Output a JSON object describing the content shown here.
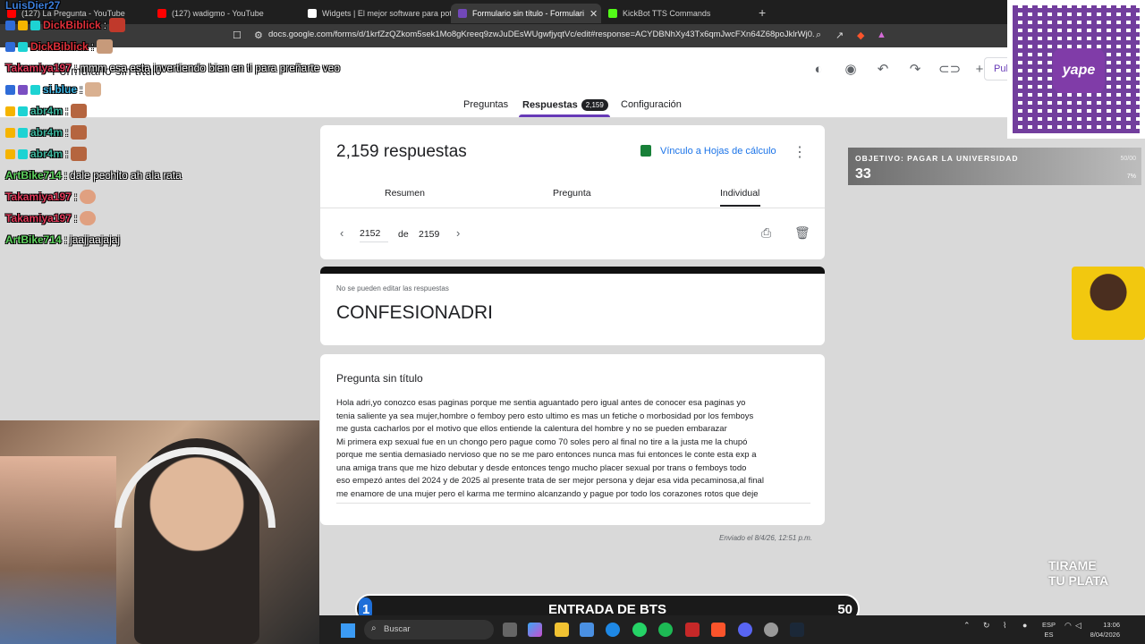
{
  "browser": {
    "tabs": [
      {
        "label": "(127) La Pregunta - YouTube",
        "color": "#ff0000",
        "active": false
      },
      {
        "label": "(127) wadigmo - YouTube",
        "color": "#ff0000",
        "active": false
      },
      {
        "label": "Widgets | El mejor software para pot",
        "color": "#ffffff",
        "active": false
      },
      {
        "label": "Formulario sin título - Formulari",
        "color": "#7248b9",
        "active": true
      },
      {
        "label": "KickBot TTS Commands",
        "color": "#53fc18",
        "active": false
      }
    ],
    "url": "docs.google.com/forms/d/1krfZzQZkom5sek1Mo8gKreeq9zwJuDEsWUgwfjyqtVc/edit#response=ACYDBNhXy43Tx6qmJwcFXn64Z68poJklrWj0..."
  },
  "form": {
    "title": "Formulario sin título",
    "publish_label": "Pul",
    "tabs": {
      "preguntas": "Preguntas",
      "respuestas": "Respuestas",
      "respuestas_badge": "2,159",
      "configuracion": "Configuración"
    },
    "summary": {
      "count_label": "2,159 respuestas",
      "sheets_link": "Vínculo a Hojas de cálculo",
      "subtabs": {
        "resumen": "Resumen",
        "pregunta": "Pregunta",
        "individual": "Individual"
      }
    },
    "pager": {
      "current": "2152",
      "of": "de",
      "total": "2159"
    },
    "response": {
      "notice": "No se pueden editar las respuestas",
      "name": "CONFESIONADRI",
      "question_title": "Pregunta sin título",
      "answer": "Hola adri,yo conozco esas paginas porque me sentia aguantado pero igual antes de conocer esa paginas yo\ntenia saliente ya sea mujer,hombre o femboy pero esto ultimo es mas un fetiche o morbosidad por los femboys\nme gusta cacharlos por el motivo que ellos entiende la calentura del hombre y no se pueden embarazar\nMi primera exp sexual fue en un chongo pero pague como 70 soles pero al final no tire a la justa me la chupó\nporque me sentia demasiado nervioso que no se me paro entonces nunca mas fui entonces le conte esta exp a\nuna amiga trans que me hizo debutar y desde entonces tengo mucho placer sexual por trans o femboys todo\neso empezó antes del 2024 y de 2025 al presente trata de ser mejor persona y dejar esa vida pecaminosa,al final\nme enamore de una mujer pero el karma me termino alcanzando y pague por todo los corazones rotos que deje",
      "sent": "Enviado el 8/4/26, 12:51 p.m."
    }
  },
  "chat": [
    {
      "user": "LuisDier27",
      "msg": "",
      "color": "#3b7dd8"
    },
    {
      "user": "DickBiblick",
      "msg": "",
      "color": "#e0303a"
    },
    {
      "user": "DickBiblick",
      "msg": "",
      "color": "#e0303a"
    },
    {
      "user": "Takamiya197",
      "msg": "mmm esa esta invertiendo bien en ti para preñarte veo",
      "color": "#e03a5a"
    },
    {
      "user": "si.blue",
      "msg": "",
      "color": "#3fb8e8"
    },
    {
      "user": "abr4m",
      "msg": "",
      "color": "#3fb8a0"
    },
    {
      "user": "abr4m",
      "msg": "",
      "color": "#3fb8a0"
    },
    {
      "user": "abr4m",
      "msg": "",
      "color": "#3fb8a0"
    },
    {
      "user": "ArtBike714",
      "msg": "dale pechito ah ala rata",
      "color": "#5fd35f"
    },
    {
      "user": "Takamiya197",
      "msg": "",
      "color": "#e03a5a"
    },
    {
      "user": "Takamiya197",
      "msg": "",
      "color": "#e03a5a"
    },
    {
      "user": "ArtBike714",
      "msg": "jaajjaajajaj",
      "color": "#5fd35f"
    }
  ],
  "goal": {
    "label": "OBJETIVO: PAGAR LA UNIVERSIDAD",
    "value": "33",
    "max": "50/00",
    "percent_label": "7%"
  },
  "donation": {
    "line1": "TIRAME",
    "line2": "TU PLATA"
  },
  "bts": {
    "current": "1",
    "title": "ENTRADA DE BTS",
    "max": "50",
    "progress": 0.02
  },
  "qr": {
    "brand": "yape"
  },
  "taskbar": {
    "search_placeholder": "Buscar",
    "lang_line1": "ESP",
    "lang_line2": "ES",
    "time": "13:06",
    "date": "8/04/2026"
  }
}
